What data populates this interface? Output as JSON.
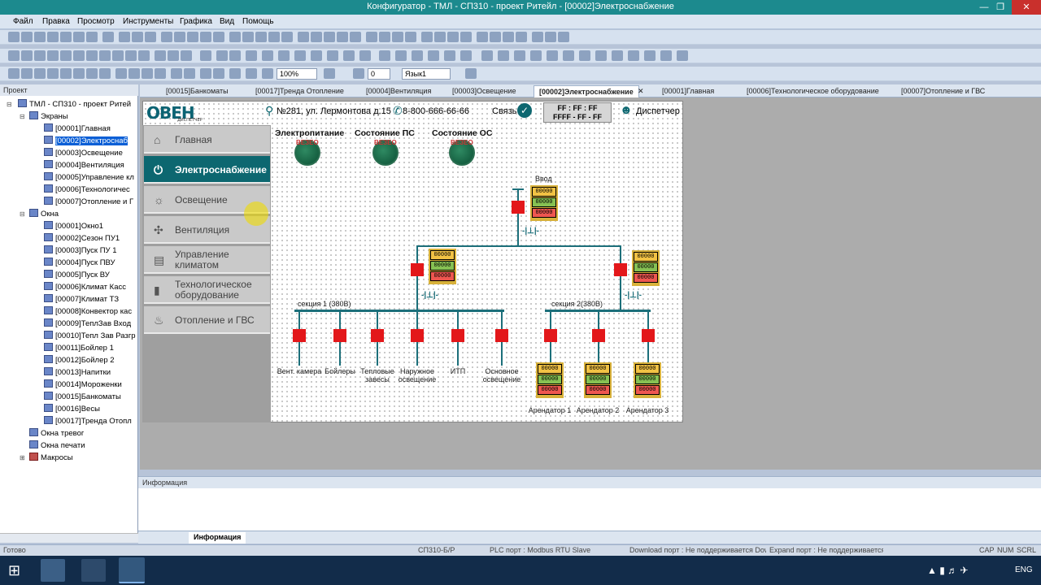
{
  "window": {
    "title": "Конфигуратор - ТМЛ - СП310 - проект Ритейл - [00002]Электроснабжение"
  },
  "menu": [
    "Файл",
    "Правка",
    "Просмотр",
    "Инструменты",
    "Графика",
    "Вид",
    "Помощь"
  ],
  "toolbar": {
    "zoom": "100%",
    "rotate": "0",
    "language": "Язык1"
  },
  "project_panel": {
    "title": "Проект",
    "root": "ТМЛ - СП310 - проект Ритей",
    "screens_label": "Экраны",
    "screens": [
      "[00001]Главная",
      "[00002]Электроснаб",
      "[00003]Освещение",
      "[00004]Вентиляция",
      "[00005]Управление кл",
      "[00006]Технологичес",
      "[00007]Отопление и Г"
    ],
    "windows_label": "Окна",
    "windows": [
      "[00001]Окно1",
      "[00002]Сезон ПУ1",
      "[00003]Пуск ПУ 1",
      "[00004]Пуск ПВУ",
      "[00005]Пуск ВУ",
      "[00006]Климат Касс",
      "[00007]Климат ТЗ",
      "[00008]Конвектор кас",
      "[00009]ТеплЗав Вход",
      "[00010]Тепл Зав Разгр",
      "[00011]Бойлер 1",
      "[00012]Бойлер 2",
      "[00013]Напитки",
      "[00014]Мороженки",
      "[00015]Банкоматы",
      "[00016]Весы",
      "[00017]Тренда Отопл"
    ],
    "alarm_windows": "Окна тревог",
    "print_windows": "Окна печати",
    "macros": "Макросы"
  },
  "tabs": [
    "[00015]Банкоматы",
    "[00017]Тренда Отопление",
    "[00004]Вентиляция",
    "[00003]Освещение",
    "[00002]Электроснабжение",
    "[00001]Главная",
    "[00006]Технологическое оборудование",
    "[00007]Отопление и ГВС"
  ],
  "screen": {
    "logo": "OBEH",
    "logo_sub": "ДИСПЕТЧЕР",
    "address": "№281, ул. Лермонтова д.15",
    "phone": "8-800-666-66-66",
    "link_label": "Связь",
    "datetime_line1": "FF : FF : FF",
    "datetime_line2": "FFFF - FF - FF",
    "user": "Диспетчер",
    "nav": [
      "Главная",
      "Электроснабжение",
      "Освещение",
      "Вентиляция",
      "Управление климатом",
      "Технологическое оборудование",
      "Отопление и ГВС"
    ],
    "statuses": [
      "Электропитание",
      "Состояние ПС",
      "Состояние ОС"
    ],
    "status_value": "ВЕЗЕО",
    "input_label": "Ввод",
    "section1": "секция 1 (380В)",
    "section2": "секция 2(380В)",
    "meter_value": "00000",
    "feeders1": [
      "Вент. камера",
      "Бойлеры",
      "Тепловые завесы",
      "Наружное освещение",
      "ИТП",
      "Основное освещение"
    ],
    "tenants": [
      "Арендатор 1",
      "Арендатор 2",
      "Арендатор 3"
    ]
  },
  "info": {
    "title": "Информация",
    "tab": "Информация"
  },
  "statusbar": {
    "ready": "Готово",
    "device": "СП310-Б/Р",
    "plc": "PLC порт : Modbus RTU Slave",
    "download": "Download порт : Не поддерживается Down",
    "expand": "Expand порт : Не поддерживается Expa",
    "caps": "CAP",
    "num": "NUM",
    "scrl": "SCRL"
  },
  "taskbar": {
    "lang": "ENG"
  }
}
